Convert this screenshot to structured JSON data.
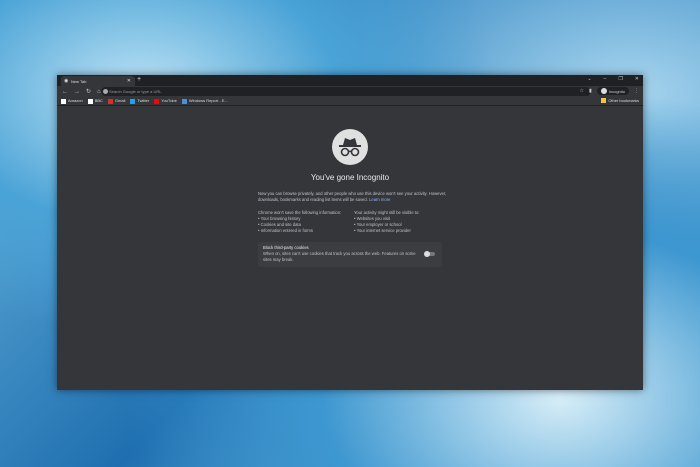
{
  "tab": {
    "title": "New Tab"
  },
  "omnibox": {
    "placeholder": "Search Google or type a URL"
  },
  "profile": {
    "label": "Incognito"
  },
  "bookmarks": [
    {
      "label": "Amazon",
      "color": "#ffffff"
    },
    {
      "label": "BBC",
      "color": "#ffffff"
    },
    {
      "label": "Gmail",
      "color": "#d93025"
    },
    {
      "label": "Twitter",
      "color": "#1da1f2"
    },
    {
      "label": "YouTube",
      "color": "#ff0000"
    },
    {
      "label": "Windows Report - E...",
      "color": "#4a90d9"
    }
  ],
  "other_bookmarks": "Other bookmarks",
  "page": {
    "title": "You've gone Incognito",
    "intro": "Now you can browse privately, and other people who use this device won't see your activity. However, downloads, bookmarks and reading list items will be saved.",
    "learn_more": "Learn more",
    "left_heading": "Chrome won't save the following information:",
    "left_items": [
      "Your browsing history",
      "Cookies and site data",
      "Information entered in forms"
    ],
    "right_heading": "Your activity might still be visible to:",
    "right_items": [
      "Websites you visit",
      "Your employer or school",
      "Your internet service provider"
    ],
    "cookies_title": "Block third-party cookies",
    "cookies_desc": "When on, sites can't use cookies that track you across the web. Features on some sites may break."
  }
}
